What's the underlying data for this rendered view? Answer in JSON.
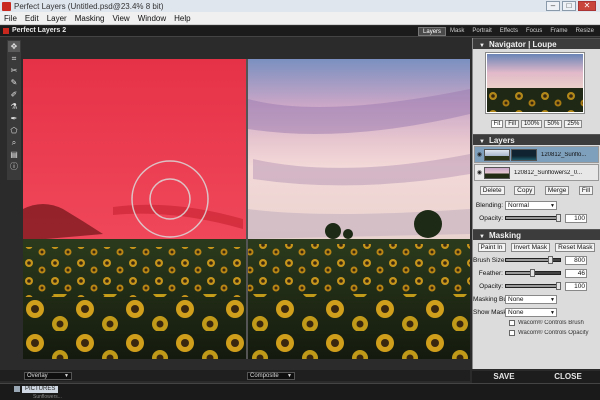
{
  "window": {
    "title": "Perfect Layers (Untitled.psd@23.4% 8 bit)",
    "controls": [
      "–",
      "□",
      "✕"
    ]
  },
  "menu": [
    "File",
    "Edit",
    "Layer",
    "Masking",
    "View",
    "Window",
    "Help"
  ],
  "app": {
    "name": "Perfect Layers 2",
    "modules": [
      "Layers",
      "Mask",
      "Portrait",
      "Effects",
      "Focus",
      "Frame",
      "Resize"
    ],
    "active_module": "Layers"
  },
  "tools": [
    "move-tool",
    "crop-tool",
    "transform-tool",
    "masking-brush-tool",
    "retouch-brush-tool",
    "paint-tool",
    "shape-tool",
    "zoom-tool",
    "hand-tool",
    "info-tool"
  ],
  "canvas": {
    "left_view_mode": "Overlay",
    "right_view_mode": "Composite"
  },
  "navigator": {
    "title": "Navigator | Loupe",
    "zoom_buttons": [
      "Fit",
      "Fill",
      "100%",
      "50%",
      "25%"
    ],
    "active_zoom": "Fit"
  },
  "layers": {
    "title": "Layers",
    "items": [
      {
        "name": "120812_Sunflo...",
        "selected": true
      },
      {
        "name": "120812_Sunflowers2_0...",
        "selected": false
      }
    ],
    "buttons": [
      "Delete",
      "Copy",
      "Merge",
      "Fill"
    ],
    "blending_label": "Blending:",
    "blending_value": "Normal",
    "opacity_label": "Opacity:",
    "opacity_value": "100"
  },
  "masking": {
    "title": "Masking",
    "buttons": [
      "Paint In",
      "Invert Mask",
      "Reset Mask"
    ],
    "brush_size_label": "Brush Size:",
    "brush_size_value": "800",
    "feather_label": "Feather:",
    "feather_value": "46",
    "opacity_label": "Opacity:",
    "opacity_value": "100",
    "masking_bug_label": "Masking Bug:",
    "masking_bug_value": "None",
    "show_mask_label": "Show Mask:",
    "show_mask_value": "None",
    "checkbox1": "Wacom® Controls Brush",
    "checkbox2": "Wacom® Controls Opacity"
  },
  "actions": {
    "save": "SAVE",
    "close": "CLOSE"
  },
  "taskbar": {
    "tab": "PICTURES",
    "sub": "Sunflowers..."
  }
}
